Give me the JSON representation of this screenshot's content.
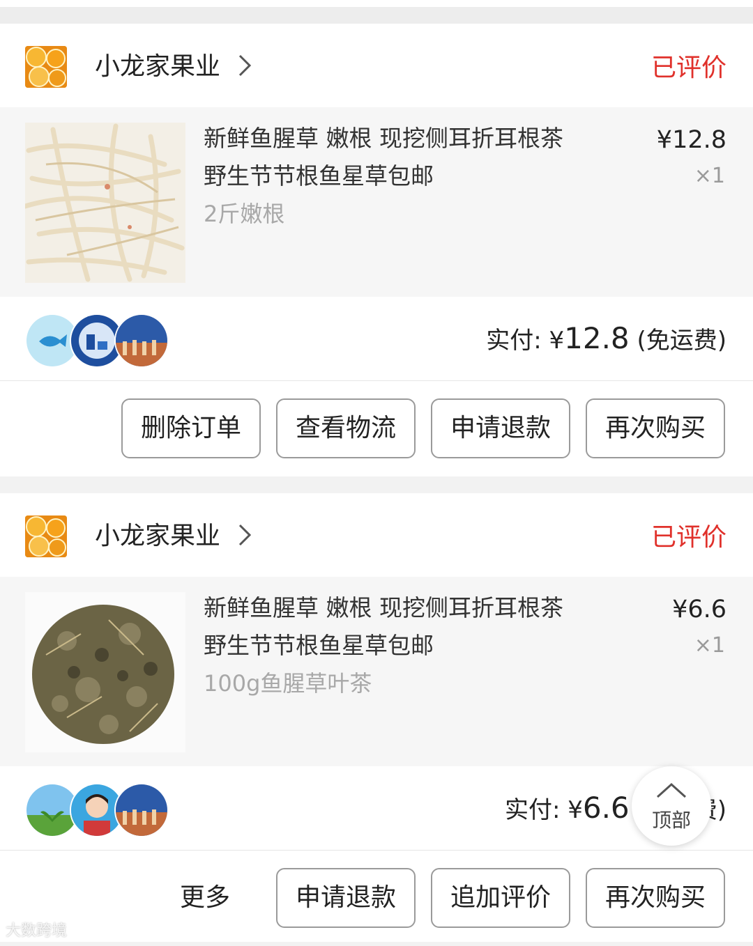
{
  "colors": {
    "status_red": "#e0312b",
    "border_gray": "#9a9a9a"
  },
  "orders": [
    {
      "shop_name": "小龙家果业",
      "status": "已评价",
      "title_line1": "新鲜鱼腥草 嫩根 现挖侧耳折耳根茶",
      "title_line2": "野生节节根鱼星草包邮",
      "spec": "2斤嫩根",
      "price": "¥12.8",
      "qty": "×1",
      "pay_label": "实付: ",
      "pay_currency": "¥",
      "pay_amount": "12.8",
      "pay_note": " (免运费)",
      "buttons": [
        "删除订单",
        "查看物流",
        "申请退款",
        "再次购买"
      ]
    },
    {
      "shop_name": "小龙家果业",
      "status": "已评价",
      "title_line1": "新鲜鱼腥草 嫩根 现挖侧耳折耳根茶",
      "title_line2": "野生节节根鱼星草包邮",
      "spec": "100g鱼腥草叶茶",
      "price": "¥6.6",
      "qty": "×1",
      "pay_label": "实付: ",
      "pay_currency": "¥",
      "pay_amount": "6.6",
      "pay_note": " (免运费)",
      "more_label": "更多",
      "buttons": [
        "申请退款",
        "追加评价",
        "再次购买"
      ]
    }
  ],
  "back_to_top": "顶部",
  "watermark": "大数跨境"
}
